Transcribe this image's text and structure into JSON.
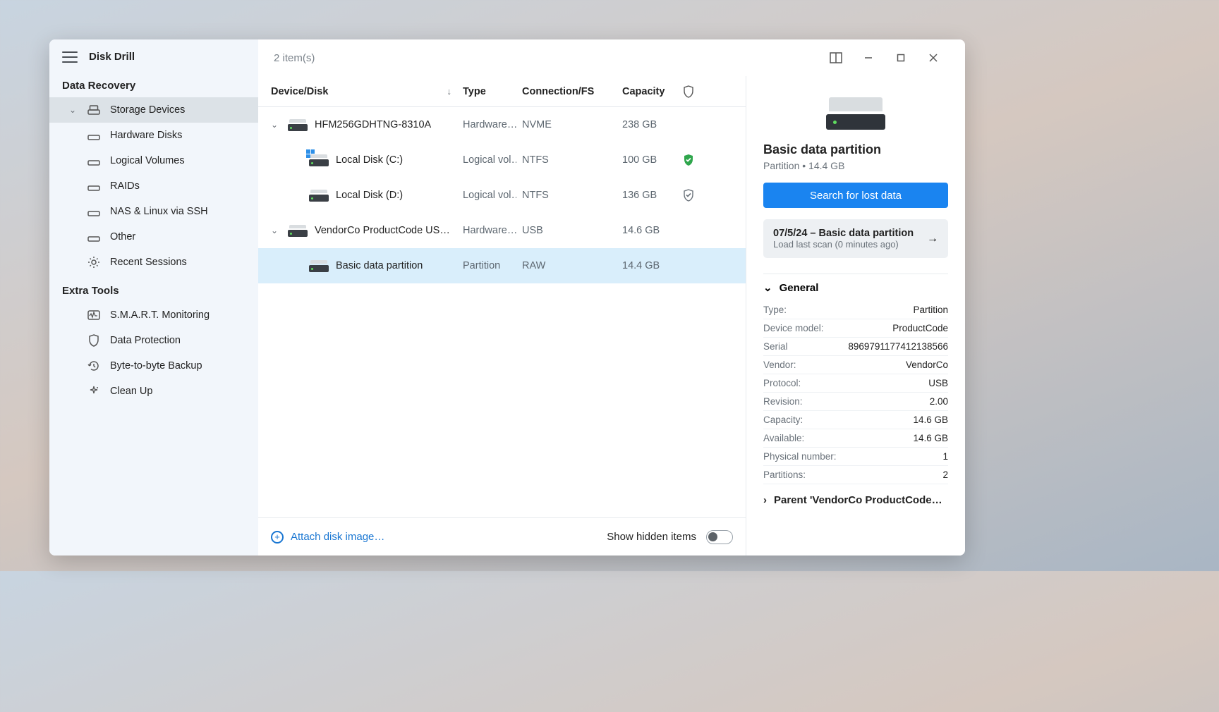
{
  "app_title": "Disk Drill",
  "topbar": {
    "item_count": "2 item(s)"
  },
  "sidebar": {
    "section_data_recovery": "Data Recovery",
    "section_extra_tools": "Extra Tools",
    "items": {
      "storage_devices": "Storage Devices",
      "hardware_disks": "Hardware Disks",
      "logical_volumes": "Logical Volumes",
      "raids": "RAIDs",
      "nas_linux": "NAS & Linux via SSH",
      "other": "Other",
      "recent_sessions": "Recent Sessions",
      "smart": "S.M.A.R.T. Monitoring",
      "data_protection": "Data Protection",
      "byte_backup": "Byte-to-byte Backup",
      "clean_up": "Clean Up"
    }
  },
  "columns": {
    "device": "Device/Disk",
    "type": "Type",
    "connection": "Connection/FS",
    "capacity": "Capacity"
  },
  "rows": [
    {
      "name": "HFM256GDHTNG-8310A",
      "type": "Hardware…",
      "conn": "NVME",
      "cap": "238 GB",
      "shield": ""
    },
    {
      "name": "Local Disk (C:)",
      "type": "Logical vol…",
      "conn": "NTFS",
      "cap": "100 GB",
      "shield": "ok"
    },
    {
      "name": "Local Disk (D:)",
      "type": "Logical vol…",
      "conn": "NTFS",
      "cap": "136 GB",
      "shield": "outline"
    },
    {
      "name": "VendorCo ProductCode US…",
      "type": "Hardware…",
      "conn": "USB",
      "cap": "14.6 GB",
      "shield": ""
    },
    {
      "name": "Basic data partition",
      "type": "Partition",
      "conn": "RAW",
      "cap": "14.4 GB",
      "shield": ""
    }
  ],
  "footer": {
    "attach": "Attach disk image…",
    "show_hidden": "Show hidden items"
  },
  "details": {
    "title": "Basic data partition",
    "subtitle": "Partition • 14.4 GB",
    "primary": "Search for lost data",
    "session_title": "07/5/24 – Basic data partition",
    "session_sub": "Load last scan (0 minutes ago)",
    "general_label": "General",
    "general": [
      {
        "k": "Type:",
        "v": "Partition"
      },
      {
        "k": "Device model:",
        "v": "ProductCode"
      },
      {
        "k": "Serial",
        "v": "8969791177412138566"
      },
      {
        "k": "Vendor:",
        "v": "VendorCo"
      },
      {
        "k": "Protocol:",
        "v": "USB"
      },
      {
        "k": "Revision:",
        "v": "2.00"
      },
      {
        "k": "Capacity:",
        "v": "14.6 GB"
      },
      {
        "k": "Available:",
        "v": "14.6 GB"
      },
      {
        "k": "Physical number:",
        "v": "1"
      },
      {
        "k": "Partitions:",
        "v": "2"
      }
    ],
    "parent_label": "Parent 'VendorCo ProductCode…"
  }
}
